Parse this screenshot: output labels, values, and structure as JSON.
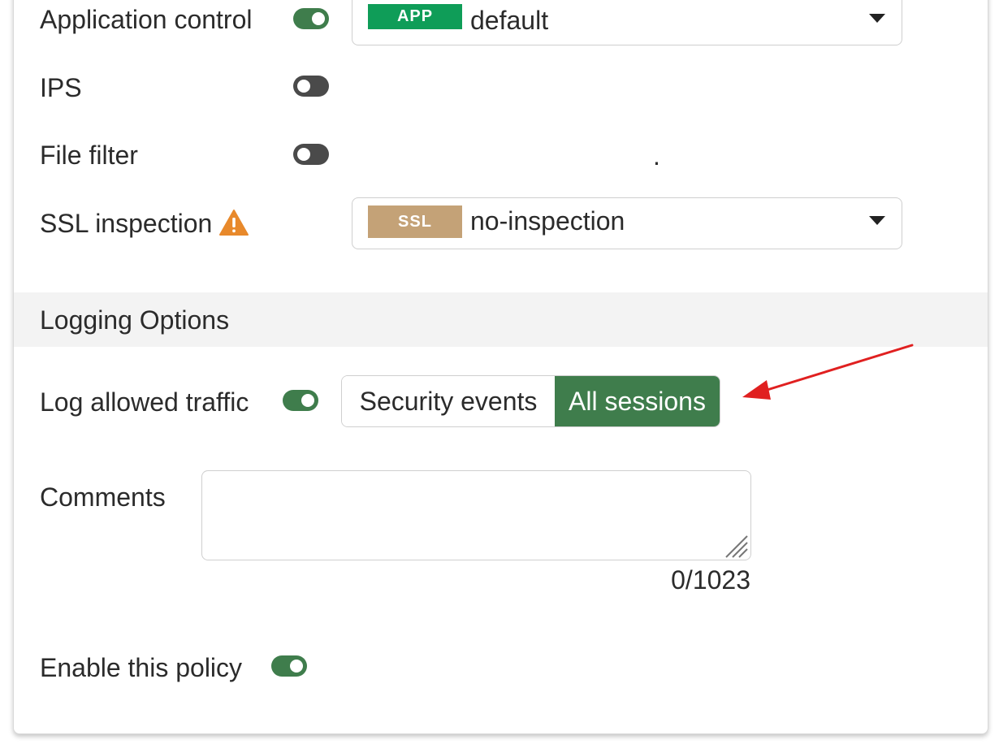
{
  "security_profiles": {
    "application_control": {
      "label": "Application control",
      "enabled": true,
      "badge": "APP",
      "badge_color": "#0f9d58",
      "value": "default"
    },
    "ips": {
      "label": "IPS",
      "enabled": false
    },
    "file_filter": {
      "label": "File filter",
      "enabled": false,
      "value": "."
    },
    "ssl_inspection": {
      "label": "SSL inspection",
      "warning_icon": "warning-triangle-icon",
      "warning_color": "#e8892b",
      "badge": "SSL",
      "badge_color": "#c4a277",
      "value": "no-inspection"
    }
  },
  "logging": {
    "section_title": "Logging Options",
    "log_allowed_traffic": {
      "label": "Log allowed traffic",
      "enabled": true,
      "options": [
        "Security events",
        "All sessions"
      ],
      "selected": "All sessions"
    }
  },
  "comments": {
    "label": "Comments",
    "value": "",
    "placeholder": "",
    "counter": "0/1023"
  },
  "enable_policy": {
    "label": "Enable this policy",
    "enabled": true
  },
  "colors": {
    "toggle_on": "#3f7d4c",
    "toggle_off": "#4a4a4a",
    "segment_active": "#3f7d4c",
    "annotation_arrow": "#e02020"
  }
}
